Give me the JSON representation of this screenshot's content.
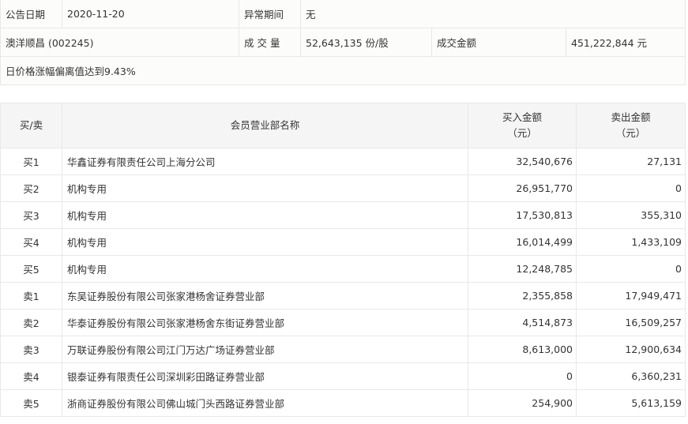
{
  "info": {
    "date_label": "公告日期",
    "date": "2020-11-20",
    "period_label": "异常期间",
    "period": "无",
    "stock": "澳洋顺昌 (002245)",
    "volume_label": "成 交 量",
    "volume": "52,643,135 份/股",
    "amount_label": "成交金额",
    "amount": "451,222,844 元",
    "reason": "日价格涨幅偏离值达到9.43%"
  },
  "table": {
    "headers": {
      "side": "买/卖",
      "name": "会员营业部名称",
      "buy": "买入金额",
      "buy_unit": "（元）",
      "sell": "卖出金额",
      "sell_unit": "（元）"
    },
    "rows": [
      {
        "side": "买1",
        "name": "华鑫证券有限责任公司上海分公司",
        "buy": "32,540,676",
        "sell": "27,131"
      },
      {
        "side": "买2",
        "name": "机构专用",
        "buy": "26,951,770",
        "sell": "0"
      },
      {
        "side": "买3",
        "name": "机构专用",
        "buy": "17,530,813",
        "sell": "355,310"
      },
      {
        "side": "买4",
        "name": "机构专用",
        "buy": "16,014,499",
        "sell": "1,433,109"
      },
      {
        "side": "买5",
        "name": "机构专用",
        "buy": "12,248,785",
        "sell": "0"
      },
      {
        "side": "卖1",
        "name": "东吴证券股份有限公司张家港杨舍证券营业部",
        "buy": "2,355,858",
        "sell": "17,949,471"
      },
      {
        "side": "卖2",
        "name": "华泰证券股份有限公司张家港杨舍东街证券营业部",
        "buy": "4,514,873",
        "sell": "16,509,257"
      },
      {
        "side": "卖3",
        "name": "万联证券股份有限公司江门万达广场证券营业部",
        "buy": "8,613,000",
        "sell": "12,900,634"
      },
      {
        "side": "卖4",
        "name": "银泰证券有限责任公司深圳彩田路证券营业部",
        "buy": "0",
        "sell": "6,360,231"
      },
      {
        "side": "卖5",
        "name": "浙商证券股份有限公司佛山城门头西路证券营业部",
        "buy": "254,900",
        "sell": "5,613,159"
      }
    ]
  }
}
